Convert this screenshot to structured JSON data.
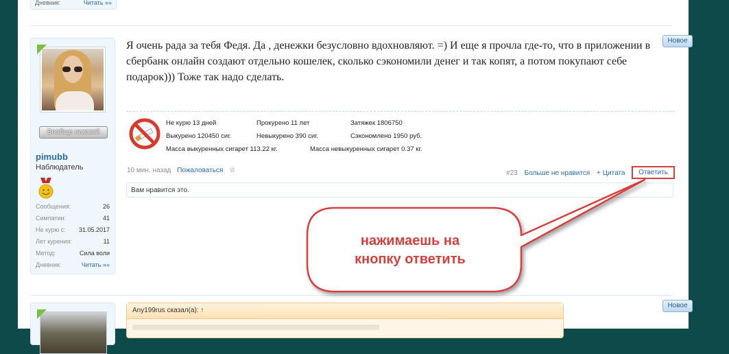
{
  "prev_post": {
    "diary_label": "Дневник:",
    "diary_value": "Читать »»"
  },
  "user": {
    "title_badge": "Вообще никакой",
    "name": "pimubb",
    "rank": "Наблюдатель",
    "stats": [
      {
        "label": "Сообщения:",
        "value": "26"
      },
      {
        "label": "Симпатии:",
        "value": "41"
      },
      {
        "label": "Не курю с:",
        "value": "31.05.2017"
      },
      {
        "label": "Лет курения:",
        "value": "11"
      },
      {
        "label": "Метод:",
        "value": "Сила воли"
      },
      {
        "label": "Дневник:",
        "value": "Читать »»"
      }
    ]
  },
  "post": {
    "badge": "Новое",
    "text": "Я очень рада за тебя Федя. Да , денежки безусловно вдохновляют. =) И еще я прочла где-то, что в приложении в сбербанк онлайн создают отдельно кошелек, сколько сэкономили денег и так копят, а потом покупают себе подарок))) Тоже так надо сделать.",
    "signature": {
      "not_smoking": "Не курю 13 дней",
      "smoked": "Прокурено 11 лет",
      "puffs": "Затяжек 1806750",
      "smoked_cigs": "Выкурено 120450 сиг.",
      "not_smoked_cigs": "Невыкурено 390 сиг.",
      "saved": "Сэкономлено 1950 руб.",
      "mass_smoked": "Масса выкуренных сигарет 113.22 кг.",
      "mass_not_smoked": "Масса невыкуренных сигарет 0.37 кг."
    },
    "time": "10 мин. назад",
    "report": "Пожаловаться",
    "star": "☆",
    "number": "#23",
    "unlike": "Больше не нравится",
    "quote": "+ Цитата",
    "reply": "Ответить",
    "likes_text": "Вам нравится это."
  },
  "callout": {
    "line1": "нажимаешь  на",
    "line2": "кнопку ответить",
    "color": "#d3413e"
  },
  "next_post": {
    "badge": "Новое",
    "quote_header": "Any199rus сказал(а): ↑"
  }
}
